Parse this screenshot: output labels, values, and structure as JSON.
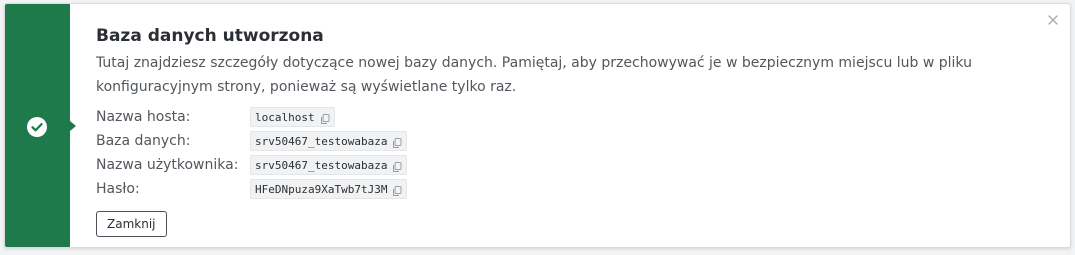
{
  "notice": {
    "title": "Baza danych utworzona",
    "description": "Tutaj znajdziesz szczegóły dotyczące nowej bazy danych. Pamiętaj, aby przechowywać je w bezpiecznym miejscu lub w pliku konfiguracyjnym strony, ponieważ są wyświetlane tylko raz.",
    "status_icon": "check-circle-icon",
    "close_icon": "close-icon",
    "accent_color": "#1e7a4a"
  },
  "details": [
    {
      "label": "Nazwa hosta:",
      "value": "localhost",
      "icon": "copy-icon"
    },
    {
      "label": "Baza danych:",
      "value": "srv50467_testowabaza",
      "icon": "copy-icon"
    },
    {
      "label": "Nazwa użytkownika:",
      "value": "srv50467_testowabaza",
      "icon": "copy-icon"
    },
    {
      "label": "Hasło:",
      "value": "HFeDNpuza9XaTwb7tJ3M",
      "icon": "copy-icon"
    }
  ],
  "actions": {
    "close_label": "Zamknij"
  }
}
